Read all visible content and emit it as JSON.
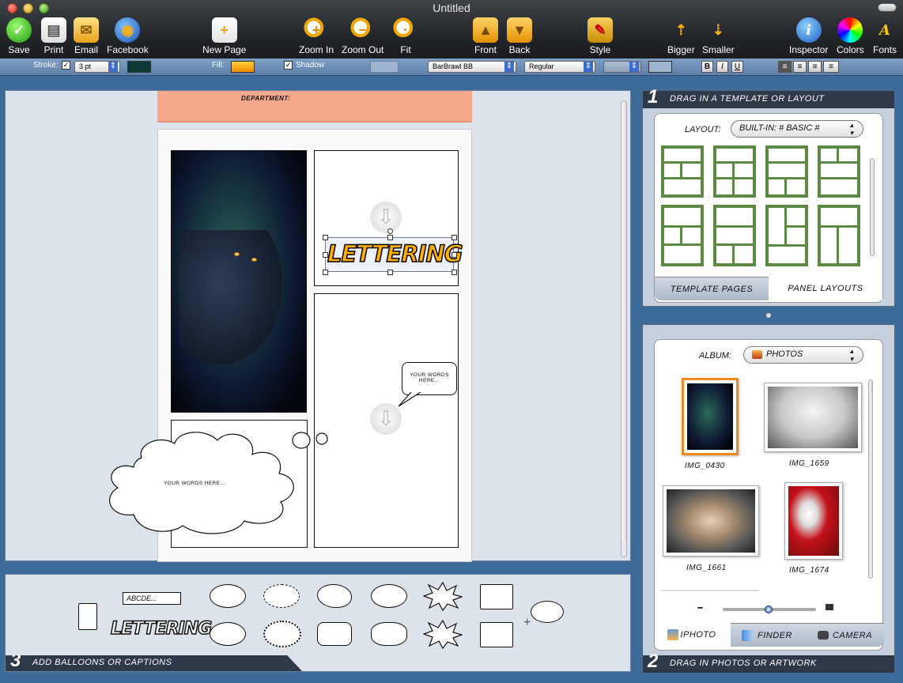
{
  "window": {
    "title": "Untitled"
  },
  "toolbar": {
    "save": "Save",
    "print": "Print",
    "email": "Email",
    "facebook": "Facebook",
    "new_page": "New Page",
    "zoom_in": "Zoom In",
    "zoom_out": "Zoom Out",
    "fit": "Fit",
    "front": "Front",
    "back": "Back",
    "style": "Style",
    "bigger": "Bigger",
    "smaller": "Smaller",
    "inspector": "Inspector",
    "colors": "Colors",
    "fonts": "Fonts"
  },
  "format_bar": {
    "stroke_label": "Stroke:",
    "stroke_checked": true,
    "stroke_value": "3 pt",
    "stroke_color": "#0c3a38",
    "fill_label": "Fill:",
    "fill_color": "#f2a000",
    "shadow_label": "Shadow",
    "shadow_checked": true,
    "font": "BarBrawl BB",
    "font_style": "Regular",
    "bold": "B",
    "italic": "I",
    "underline": "U"
  },
  "page": {
    "header_text": "DEPARTMENT:",
    "lettering_text": "LETTERING",
    "speech_bubble_text": "YOUR WORDS HERE...",
    "thought_bubble_text": "YOUR WORDS HERE..."
  },
  "bottom": {
    "step_number": "3",
    "title": "Add balloons or captions",
    "caption_placeholder": "ABCDE...",
    "lettering_sample": "LETTERING"
  },
  "templates_panel": {
    "step_number": "1",
    "title": "Drag in a template or layout",
    "layout_label": "LAYOUT:",
    "layout_value": "BUILT-IN: # BASIC #",
    "tabs": [
      "TEMPLATE PAGES",
      "PANEL LAYOUTS"
    ],
    "active_tab": "PANEL LAYOUTS"
  },
  "photos_panel": {
    "step_number": "2",
    "title": "Drag in photos or artwork",
    "album_label": "ALBUM:",
    "album_value": "PHOTOS",
    "photos": [
      "IMG_0430",
      "IMG_1659",
      "IMG_1661",
      "IMG_1674"
    ],
    "selected_photo": "IMG_0430",
    "tabs": [
      "IPHOTO",
      "FINDER",
      "CAMERA"
    ],
    "active_tab": "IPHOTO",
    "slider_value": 0.5
  }
}
